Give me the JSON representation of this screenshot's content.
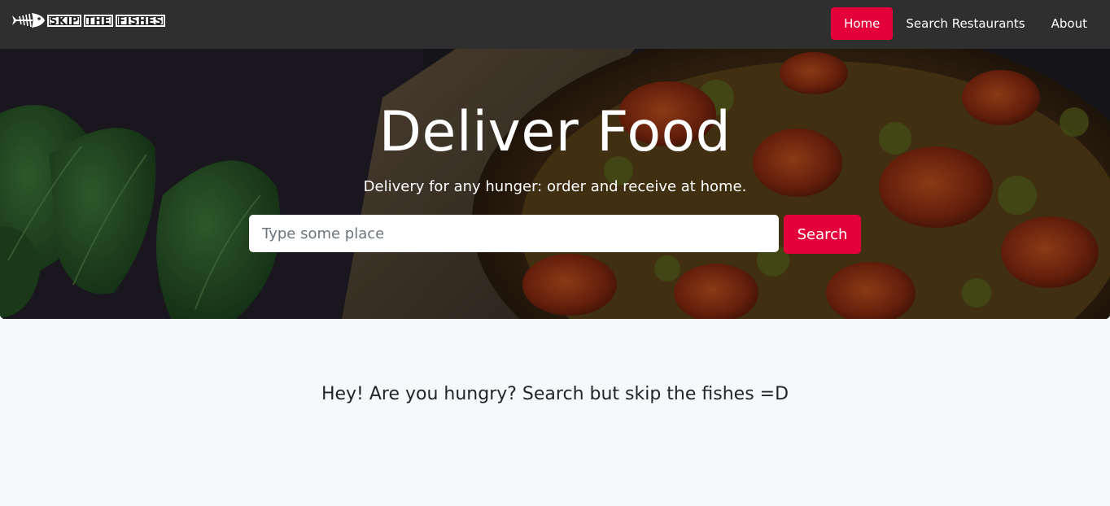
{
  "navbar": {
    "brand_words": [
      "SKIP",
      "THE",
      "FISHES"
    ],
    "logo_icon": "fish-skeleton-icon",
    "links": [
      {
        "label": "Home",
        "active": true
      },
      {
        "label": "Search Restaurants",
        "active": false
      },
      {
        "label": "About",
        "active": false
      }
    ]
  },
  "hero": {
    "title": "Deliver Food",
    "subtitle": "Delivery for any hunger: order and receive at home.",
    "search": {
      "placeholder": "Type some place",
      "value": "",
      "button_label": "Search"
    }
  },
  "main": {
    "tagline": "Hey! Are you hungry? Search but skip the fishes =D"
  },
  "colors": {
    "accent": "#e4003a",
    "navbar_bg": "#2f2f2f",
    "page_bg": "#f7f8fa"
  }
}
